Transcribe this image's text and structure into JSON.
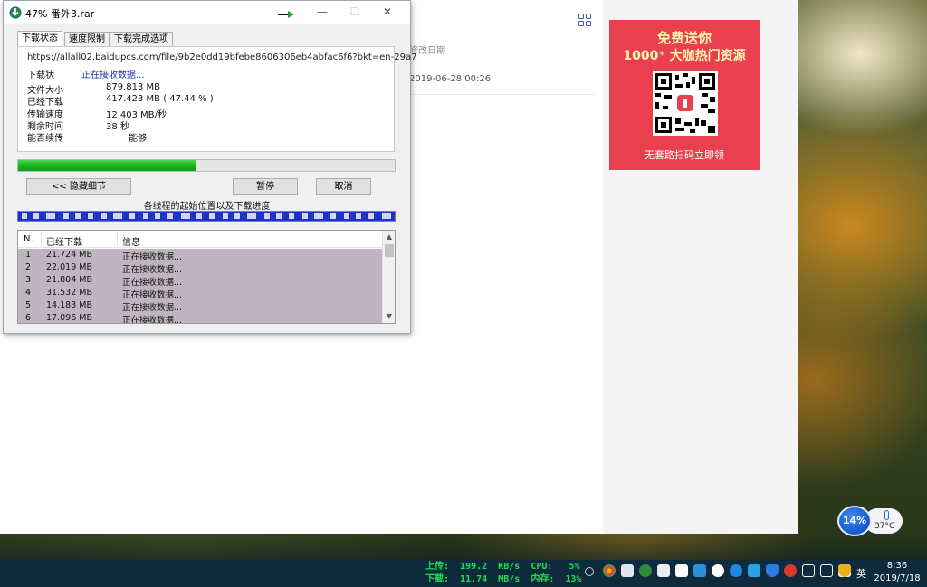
{
  "dialog": {
    "title": "47% 番外3.rar",
    "tabs": [
      {
        "label": "下载状态",
        "active": true
      },
      {
        "label": "速度限制",
        "active": false
      },
      {
        "label": "下载完成选项",
        "active": false
      }
    ],
    "url": "https://allall02.baidupcs.com/file/9b2e0dd19bfebe8606306eb4abfac6f6?bkt=en-29a7",
    "status_label": "下载状",
    "status_value": "正在接收数据...",
    "fields": {
      "file_size_label": "文件大小",
      "file_size_value": "879.813  MB",
      "downloaded_label": "已经下载",
      "downloaded_value": "417.423  MB  ( 47.44 % )",
      "speed_label": "传输速度",
      "speed_value": "12.403  MB/秒",
      "remaining_label": "剩余时间",
      "remaining_value": "38 秒",
      "resume_label": "能否续传",
      "resume_value": "能够"
    },
    "progress_fraction": 0.4744,
    "buttons": {
      "hide_details": "<< 隐藏细节",
      "pause": "暂停",
      "cancel": "取消"
    },
    "threads_label": "各线程的起始位置以及下载进度",
    "list": {
      "headers": [
        "N.",
        "已经下载",
        "信息"
      ],
      "rows": [
        {
          "n": "1",
          "downloaded": "21.724  MB",
          "info": "正在接收数据..."
        },
        {
          "n": "2",
          "downloaded": "22.019  MB",
          "info": "正在接收数据..."
        },
        {
          "n": "3",
          "downloaded": "21.804  MB",
          "info": "正在接收数据..."
        },
        {
          "n": "4",
          "downloaded": "31.532  MB",
          "info": "正在接收数据..."
        },
        {
          "n": "5",
          "downloaded": "14.183  MB",
          "info": "正在接收数据..."
        },
        {
          "n": "6",
          "downloaded": "17.096  MB",
          "info": "正在接收数据..."
        }
      ]
    },
    "window_buttons": {
      "minimize": "—",
      "maximize": "☐",
      "close": "✕"
    }
  },
  "browser": {
    "column_header": "修改日期",
    "row_date": "2019-06-28 00:26",
    "ad": {
      "line1": "免费送你",
      "line2": "1000⁺ 大咖热门资源",
      "line3": "无套路扫码立即领"
    }
  },
  "weather": {
    "percent": "14%",
    "temperature": "37°C"
  },
  "taskbar": {
    "netmon_line1": "上传:  199.2  KB/s  CPU:   5%",
    "netmon_line2": "下载:  11.74  MB/s  内存:  13%",
    "ime_label": "英",
    "time": "8:36",
    "date": "2019/7/18"
  },
  "colors": {
    "progress": "#15b31f",
    "thread_bar": "#1f33c2",
    "status_text": "#1b2fb0",
    "ad_bg": "#e8404f",
    "netmon": "#19e34a"
  }
}
